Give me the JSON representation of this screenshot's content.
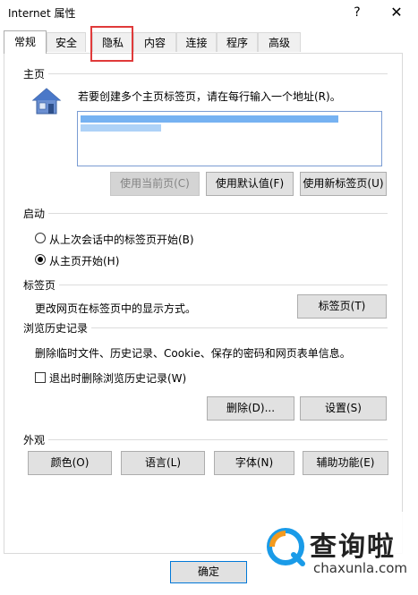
{
  "window": {
    "title": "Internet 属性",
    "help_label": "?",
    "close_label": "✕"
  },
  "tabs": [
    {
      "label": "常规",
      "active": true
    },
    {
      "label": "安全"
    },
    {
      "label": "隐私"
    },
    {
      "label": "内容"
    },
    {
      "label": "连接"
    },
    {
      "label": "程序"
    },
    {
      "label": "高级"
    }
  ],
  "homepage": {
    "section_title": "主页",
    "instruction": "若要创建多个主页标签页，请在每行输入一个地址(R)。",
    "icon": "home-icon",
    "buttons": {
      "use_current": "使用当前页(C)",
      "use_default": "使用默认值(F)",
      "use_new_tab": "使用新标签页(U)"
    }
  },
  "startup": {
    "section_title": "启动",
    "option_last_session": "从上次会话中的标签页开始(B)",
    "option_homepage": "从主页开始(H)",
    "selected": "homepage"
  },
  "tabs_section": {
    "section_title": "标签页",
    "description": "更改网页在标签页中的显示方式。",
    "button": "标签页(T)"
  },
  "history": {
    "section_title": "浏览历史记录",
    "description": "删除临时文件、历史记录、Cookie、保存的密码和网页表单信息。",
    "checkbox_label": "退出时删除浏览历史记录(W)",
    "checked": false,
    "delete_button": "删除(D)...",
    "settings_button": "设置(S)"
  },
  "appearance": {
    "section_title": "外观",
    "buttons": {
      "colors": "颜色(O)",
      "languages": "语言(L)",
      "fonts": "字体(N)",
      "accessibility": "辅助功能(E)"
    }
  },
  "footer": {
    "ok": "确定"
  },
  "watermark": {
    "name": "查询啦",
    "url": "chaxunla.com"
  },
  "colors": {
    "accent": "#0078d7",
    "highlight_box": "#e03a3a",
    "url_selection": "#5ea5f0"
  }
}
